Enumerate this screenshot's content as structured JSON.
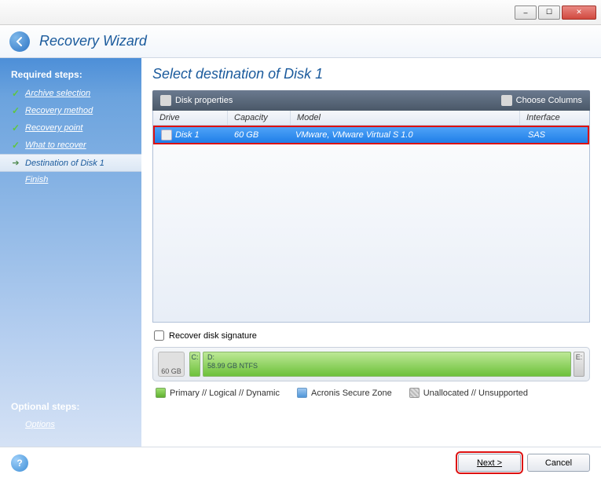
{
  "window": {
    "minimize": "–",
    "maximize": "☐",
    "close": "✕"
  },
  "header": {
    "title": "Recovery Wizard"
  },
  "sidebar": {
    "required_heading": "Required steps:",
    "optional_heading": "Optional steps:",
    "items": [
      {
        "label": "Archive selection",
        "state": "done"
      },
      {
        "label": "Recovery method",
        "state": "done"
      },
      {
        "label": "Recovery point",
        "state": "done"
      },
      {
        "label": "What to recover",
        "state": "done"
      },
      {
        "label": "Destination of Disk 1",
        "state": "current"
      },
      {
        "label": "Finish",
        "state": "pending"
      }
    ],
    "options_link": "Options"
  },
  "content": {
    "title": "Select destination of Disk 1",
    "toolbar": {
      "disk_properties": "Disk properties",
      "choose_columns": "Choose Columns"
    },
    "columns": {
      "drive": "Drive",
      "capacity": "Capacity",
      "model": "Model",
      "interface": "Interface"
    },
    "rows": [
      {
        "drive": "Disk 1",
        "capacity": "60 GB",
        "model": "VMware, VMware Virtual S 1.0",
        "interface": "SAS"
      }
    ],
    "recover_signature": "Recover disk signature",
    "diskbar": {
      "total": "60 GB",
      "c_label": "C:",
      "d_label": "D:",
      "d_size": "58.99 GB  NTFS",
      "e_label": "E:"
    },
    "legend": {
      "primary": "Primary // Logical // Dynamic",
      "secure": "Acronis Secure Zone",
      "unalloc": "Unallocated // Unsupported"
    }
  },
  "footer": {
    "next": "Next >",
    "cancel": "Cancel"
  }
}
